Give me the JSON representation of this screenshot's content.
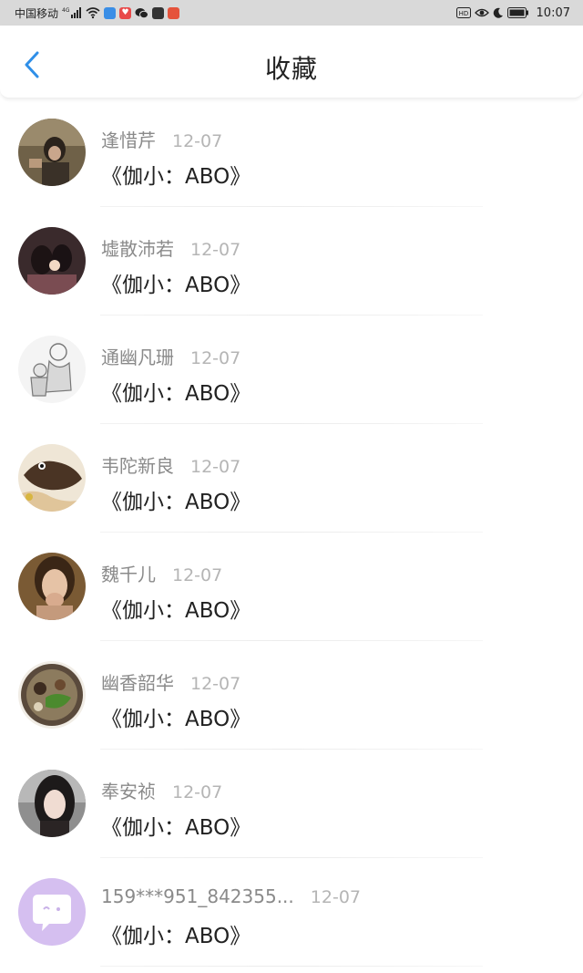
{
  "status_bar": {
    "carrier": "中国移动",
    "network": "4G",
    "time": "10:07",
    "hd_label": "HD"
  },
  "header": {
    "title": "收藏",
    "back_icon": "chevron-left-icon"
  },
  "colors": {
    "accent": "#2f8fe8",
    "username": "#8a8a8a",
    "date": "#b5b5b5",
    "title": "#222222"
  },
  "favorites": [
    {
      "username": "逢惜芹",
      "date": "12-07",
      "title": "《伽小：ABO》"
    },
    {
      "username": "墟散沛若",
      "date": "12-07",
      "title": "《伽小：ABO》"
    },
    {
      "username": "通幽凡珊",
      "date": "12-07",
      "title": "《伽小：ABO》"
    },
    {
      "username": "韦陀新良",
      "date": "12-07",
      "title": "《伽小：ABO》"
    },
    {
      "username": "魏千儿",
      "date": "12-07",
      "title": "《伽小：ABO》"
    },
    {
      "username": "幽香韶华",
      "date": "12-07",
      "title": "《伽小：ABO》"
    },
    {
      "username": "奉安祯",
      "date": "12-07",
      "title": "《伽小：ABO》"
    },
    {
      "username": "159***951_842355...",
      "date": "12-07",
      "title": "《伽小：ABO》"
    }
  ]
}
